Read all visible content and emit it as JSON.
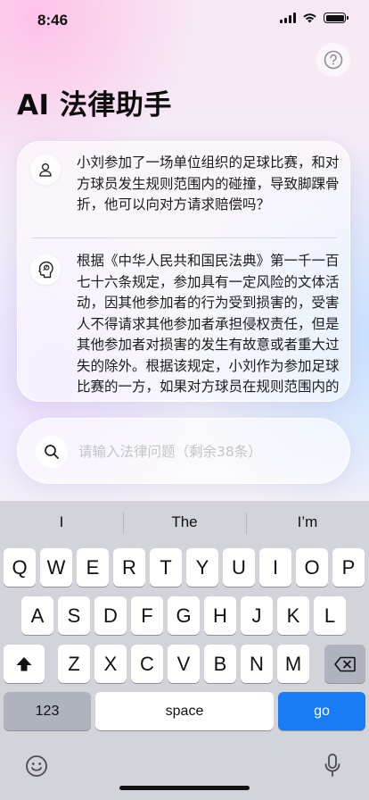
{
  "status_bar": {
    "time": "8:46"
  },
  "header": {
    "title": "AI 法律助手",
    "help_icon": "question-circle-icon"
  },
  "chat": {
    "user_message": "小刘参加了一场单位组织的足球比赛，和对方球员发生规则范围内的碰撞，导致脚踝骨折，他可以向对方请求赔偿吗？",
    "ai_message": "根据《中华人民共和国民法典》第一千一百七十六条规定，参加具有一定风险的文体活动，因其他参加者的行为受到损害的，受害人不得请求其他参加者承担侵权责任，但是其他参加者对损害的发生有故意或者重大过失的除外。根据该规定，小刘作为参加足球比赛的一方，如果对方球员在规则范围内的行为",
    "user_avatar_icon": "person-icon",
    "ai_avatar_icon": "brain-head-icon"
  },
  "search": {
    "placeholder": "请输入法律问题（剩余38条）",
    "value": ""
  },
  "keyboard": {
    "suggestions": [
      "I",
      "The",
      "I’m"
    ],
    "row1": [
      "Q",
      "W",
      "E",
      "R",
      "T",
      "Y",
      "U",
      "I",
      "O",
      "P"
    ],
    "row2": [
      "A",
      "S",
      "D",
      "F",
      "G",
      "H",
      "J",
      "K",
      "L"
    ],
    "row3": [
      "Z",
      "X",
      "C",
      "V",
      "B",
      "N",
      "M"
    ],
    "numbers_label": "123",
    "space_label": "space",
    "go_label": "go",
    "accent_color": "#1a7cf5"
  }
}
